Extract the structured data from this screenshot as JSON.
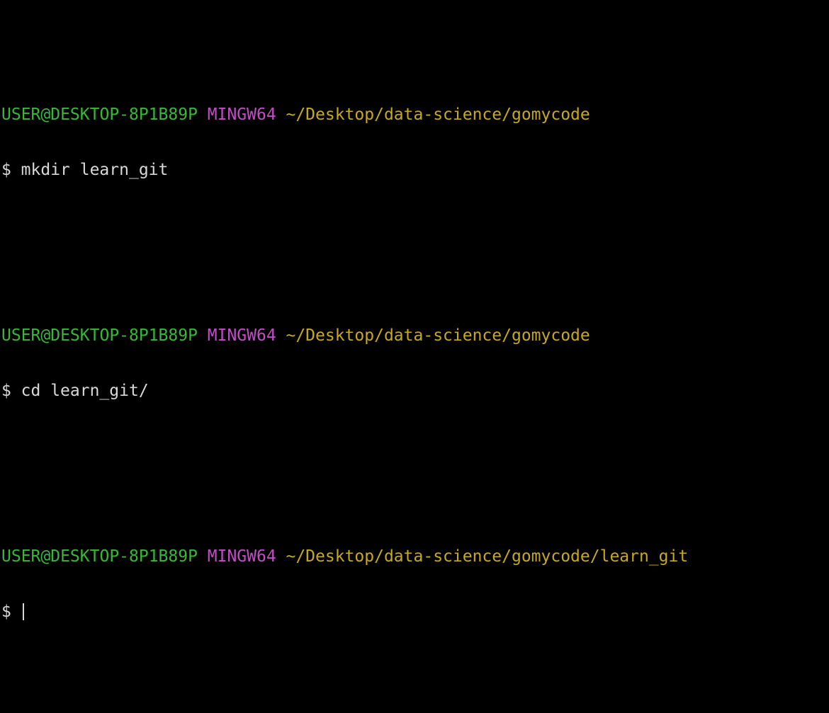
{
  "colors": {
    "background": "#000000",
    "user_host": "#37b838",
    "system": "#c14ec6",
    "path": "#c7a91c",
    "text": "#d8d8d8"
  },
  "blocks": [
    {
      "user_host": "USER@DESKTOP-8P1B89P",
      "system": "MINGW64",
      "path": "~/Desktop/data-science/gomycode",
      "prompt_symbol": "$",
      "command": "mkdir learn_git"
    },
    {
      "user_host": "USER@DESKTOP-8P1B89P",
      "system": "MINGW64",
      "path": "~/Desktop/data-science/gomycode",
      "prompt_symbol": "$",
      "command": "cd learn_git/"
    },
    {
      "user_host": "USER@DESKTOP-8P1B89P",
      "system": "MINGW64",
      "path": "~/Desktop/data-science/gomycode/learn_git",
      "prompt_symbol": "$",
      "command": ""
    }
  ]
}
